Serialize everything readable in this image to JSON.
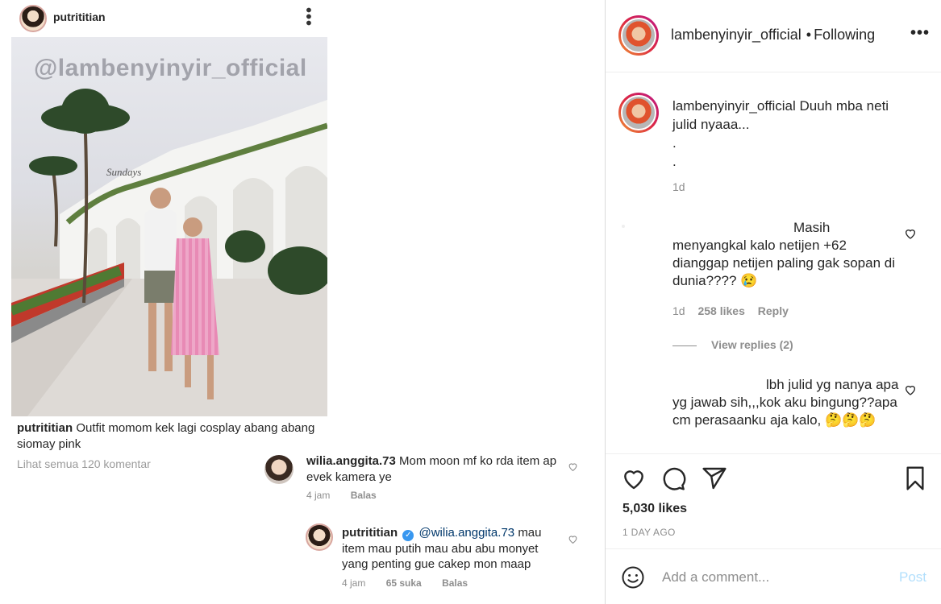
{
  "left_post": {
    "username": "putrititian",
    "watermark": "@lambenyinyir_official",
    "caption_user": "putrititian",
    "caption_text": "Outfit momom kek lagi cosplay abang abang siomay pink",
    "see_all_comments": "Lihat semua 120 komentar",
    "comments": [
      {
        "user": "wilia.anggita.73",
        "text": "Mom moon mf ko rda item ap evek kamera ye",
        "time": "4 jam",
        "reply": "Balas"
      },
      {
        "user": "putrititian",
        "mention": "@wilia.anggita.73",
        "text": "mau item mau putih mau abu abu monyet yang penting gue cakep mon maap",
        "time": "4 jam",
        "likes": "65 suka",
        "reply": "Balas"
      }
    ]
  },
  "right_panel": {
    "header": {
      "username": "lambenyinyir_official",
      "separator": "•",
      "following": "Following"
    },
    "caption": {
      "username": "lambenyinyir_official",
      "text": "Duuh mba neti julid nyaaa...",
      "line2": ".",
      "line3": ".",
      "time": "1d"
    },
    "comments": [
      {
        "text": "Masih menyangkal kalo netijen +62 dianggap netijen paling gak sopan di dunia???? 😢",
        "time": "1d",
        "likes": "258 likes",
        "reply": "Reply",
        "view_replies": "View replies (2)"
      },
      {
        "text": "lbh julid yg nanya apa yg jawab sih,,,kok aku bingung??apa cm perasaanku aja kalo, 🤔🤔🤔"
      }
    ],
    "likes": "5,030 likes",
    "date": "1 DAY AGO",
    "comment_placeholder": "Add a comment...",
    "post_label": "Post"
  },
  "colors": {
    "link": "#00376b",
    "verified": "#3897f0",
    "post_disabled": "#b2dffc",
    "muted": "#8e8e8e"
  },
  "icons": [
    "more-icon",
    "heart-icon",
    "comment-icon",
    "share-icon",
    "bookmark-icon",
    "emoji-icon",
    "verified-icon"
  ]
}
